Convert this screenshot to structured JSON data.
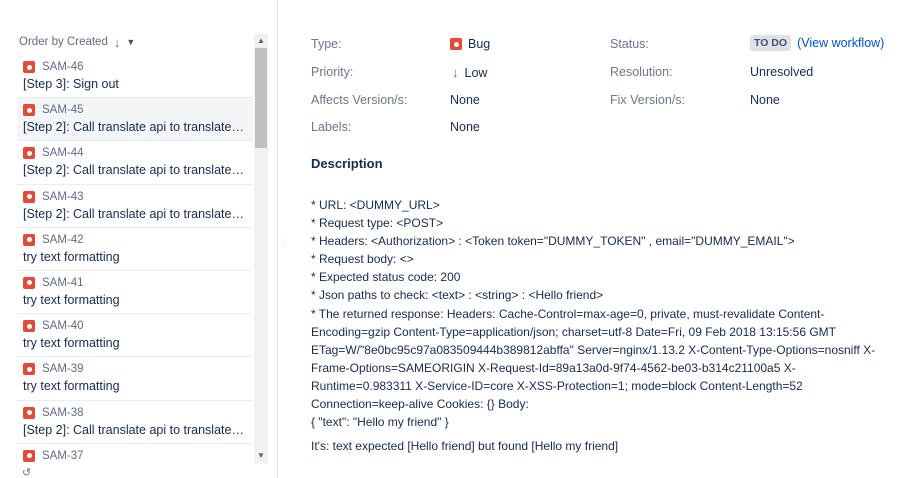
{
  "sort": {
    "label": "Order by Created",
    "direction_icon": "arrow-down-icon",
    "menu_icon": "chevron-down-icon"
  },
  "issues": [
    {
      "key": "SAM-46",
      "summary": "[Step 3]: Sign out"
    },
    {
      "key": "SAM-45",
      "summary": "[Step 2]: Call translate api to translate ...",
      "selected": true
    },
    {
      "key": "SAM-44",
      "summary": "[Step 2]: Call translate api to translate ..."
    },
    {
      "key": "SAM-43",
      "summary": "[Step 2]: Call translate api to translate ..."
    },
    {
      "key": "SAM-42",
      "summary": "try text formatting"
    },
    {
      "key": "SAM-41",
      "summary": "try text formatting"
    },
    {
      "key": "SAM-40",
      "summary": "try text formatting"
    },
    {
      "key": "SAM-39",
      "summary": "try text formatting"
    },
    {
      "key": "SAM-38",
      "summary": "[Step 2]: Call translate api to translate ..."
    },
    {
      "key": "SAM-37",
      "summary": ""
    }
  ],
  "details": {
    "type_label": "Type:",
    "type_value": "Bug",
    "priority_label": "Priority:",
    "priority_value": "Low",
    "affects_label": "Affects Version/s:",
    "affects_value": "None",
    "labels_label": "Labels:",
    "labels_value": "None",
    "status_label": "Status:",
    "status_value": "TO DO",
    "workflow_link": "(View workflow)",
    "resolution_label": "Resolution:",
    "resolution_value": "Unresolved",
    "fix_label": "Fix Version/s:",
    "fix_value": "None"
  },
  "description": {
    "heading": "Description",
    "lines": [
      "* URL: <DUMMY_URL>",
      "* Request type: <POST>",
      "* Headers: <Authorization> : <Token token=\"DUMMY_TOKEN\" , email=\"DUMMY_EMAIL\">",
      "* Request body: <>",
      "* Expected status code: 200",
      "* Json paths to check: <text> : <string> : <Hello friend>"
    ],
    "response": "* The returned response: Headers: Cache-Control=max-age=0, private, must-revalidate Content-Encoding=gzip Content-Type=application/json; charset=utf-8 Date=Fri, 09 Feb 2018 13:15:56 GMT ETag=W/\"8e0bc95c97a083509444b389812abffa\" Server=nginx/1.13.2 X-Content-Type-Options=nosniff X-Frame-Options=SAMEORIGIN X-Request-Id=89a13a0d-9f74-4562-be03-b314c21100a5 X-Runtime=0.983311 X-Service-ID=core X-XSS-Protection=1; mode=block Content-Length=52 Connection=keep-alive Cookies: {} Body:",
    "body": "{ \"text\": \"Hello my friend\" }",
    "result": "It's: text expected [Hello friend] but found [Hello my friend]"
  },
  "colors": {
    "bug": "#e5493a",
    "low_priority": "#2a8735",
    "link": "#0052cc"
  }
}
